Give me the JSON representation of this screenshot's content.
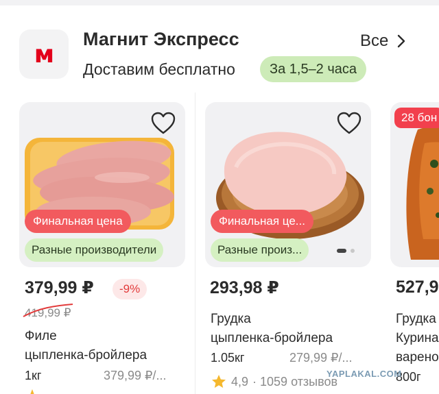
{
  "store": {
    "logo_letter": "м",
    "name": "Магнит Экспресс",
    "subtitle": "Доставим бесплатно",
    "delivery_time": "За 1,5–2 часа",
    "all_label": "Все",
    "brand_color": "#e3001b"
  },
  "products": [
    {
      "badge_final": "Финальная цена",
      "badge_producer": "Разные производители",
      "price": "379,99 ₽",
      "discount": "-9%",
      "old_price": "419,99 ₽",
      "title_lines": [
        "Филе",
        "цыпленка-бройлера"
      ],
      "weight": "1кг",
      "unit_price": "379,99 ₽/..."
    },
    {
      "badge_final": "Финальная це...",
      "badge_producer": "Разные произ...",
      "price": "293,98 ₽",
      "title_lines": [
        "Грудка",
        "цыпленка-бройлера"
      ],
      "weight": "1.05кг",
      "unit_price": "279,99 ₽/...",
      "rating": "4,9",
      "reviews": "· 1059 отзывов"
    },
    {
      "bonus": "28 бон",
      "price": "527,9",
      "title_lines": [
        "Грудка",
        "Курина",
        "варено"
      ],
      "weight": "800г"
    }
  ],
  "icons": [
    "heart-icon",
    "chevron-right-icon",
    "star-icon"
  ],
  "colors": {
    "final_price_badge": "#f25a5e",
    "producer_badge": "#d5f0c2",
    "delivery_pill": "#cdebb8",
    "discount": "#e23b3b"
  },
  "watermark": "YAPLAKAL.COM"
}
